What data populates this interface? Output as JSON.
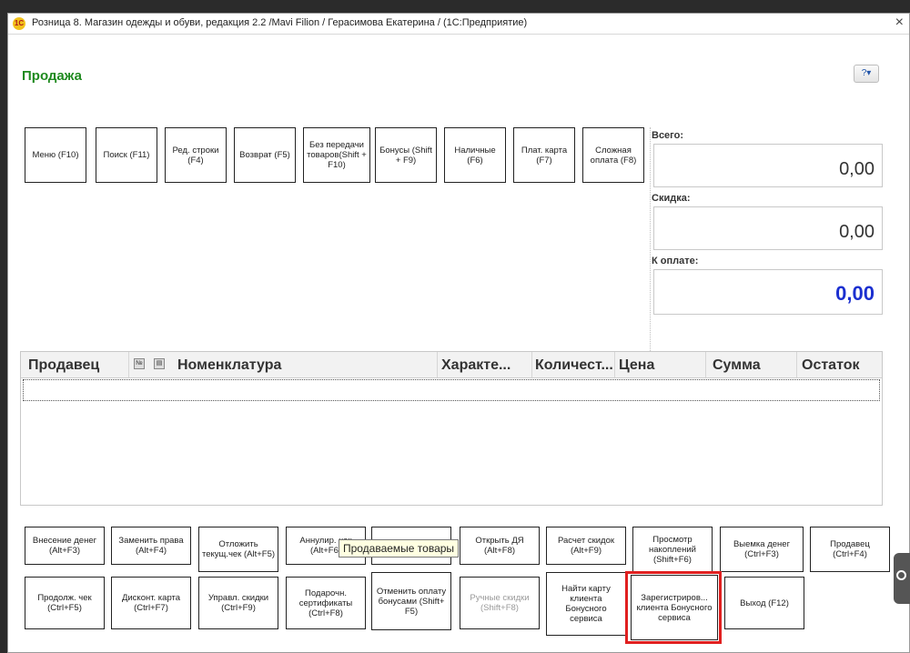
{
  "window": {
    "title": "Розница 8. Магазин одежды и обуви, редакция 2.2 /Mavi Filion / Герасимова Екатерина /  (1С:Предприятие)",
    "close": "×",
    "logo": "1С"
  },
  "form": {
    "title": "Продажа",
    "help": "?▾"
  },
  "top_buttons": [
    {
      "label": "Меню (F10)"
    },
    {
      "label": "Поиск (F11)"
    },
    {
      "label": "Ред. строки (F4)"
    },
    {
      "label": "Возврат (F5)"
    },
    {
      "label": "Без передачи товаров(Shift + F10)"
    },
    {
      "label": "Бонусы (Shift + F9)"
    },
    {
      "label": "Наличные (F6)"
    },
    {
      "label": "Плат. карта (F7)"
    },
    {
      "label": "Сложная оплата (F8)"
    }
  ],
  "summary": {
    "total_label": "Всего:",
    "total_value": "0,00",
    "discount_label": "Скидка:",
    "discount_value": "0,00",
    "topay_label": "К оплате:",
    "topay_value": "0,00",
    "topay_color": "#1b2fd0"
  },
  "table": {
    "columns": [
      "Продавец",
      "Номенклатура",
      "Характе...",
      "Количест...",
      "Цена",
      "Сумма",
      "Остаток"
    ],
    "icons": [
      "number-icon",
      "barcode-icon"
    ],
    "icon_glyphs": [
      "№",
      "▤"
    ]
  },
  "bottom_row1": [
    {
      "label": "Внесение денег (Alt+F3)"
    },
    {
      "label": "Заменить права (Alt+F4)"
    },
    {
      "label": "Отложить текущ.чек (Alt+F5)"
    },
    {
      "label": "Аннулир. чек (Alt+F6)"
    },
    {
      "label": ""
    },
    {
      "label": "Открыть ДЯ (Alt+F8)"
    },
    {
      "label": "Расчет скидок (Alt+F9)"
    },
    {
      "label": "Просмотр накоплений (Shift+F6)"
    },
    {
      "label": "Выемка денег (Ctrl+F3)"
    },
    {
      "label": "Продавец (Ctrl+F4)"
    }
  ],
  "bottom_row2": [
    {
      "label": "Продолж. чек (Ctrl+F5)"
    },
    {
      "label": "Дисконт. карта (Ctrl+F7)"
    },
    {
      "label": "Управл. скидки (Ctrl+F9)"
    },
    {
      "label": "Подарочн. сертификаты (Ctrl+F8)"
    },
    {
      "label": "Отменить оплату бонусами (Shift+ F5)"
    },
    {
      "label": "Ручные скидки (Shift+F8)",
      "disabled": true
    },
    {
      "label": "Найти карту клиента Бонусного сервиса"
    },
    {
      "label": "Зарегистриров... клиента Бонусного сервиса"
    },
    {
      "label": "Выход (F12)"
    }
  ],
  "tooltip": "Продаваемые товары",
  "colors": {
    "title_green": "#1f8a1f",
    "highlight_red": "#e02020"
  }
}
